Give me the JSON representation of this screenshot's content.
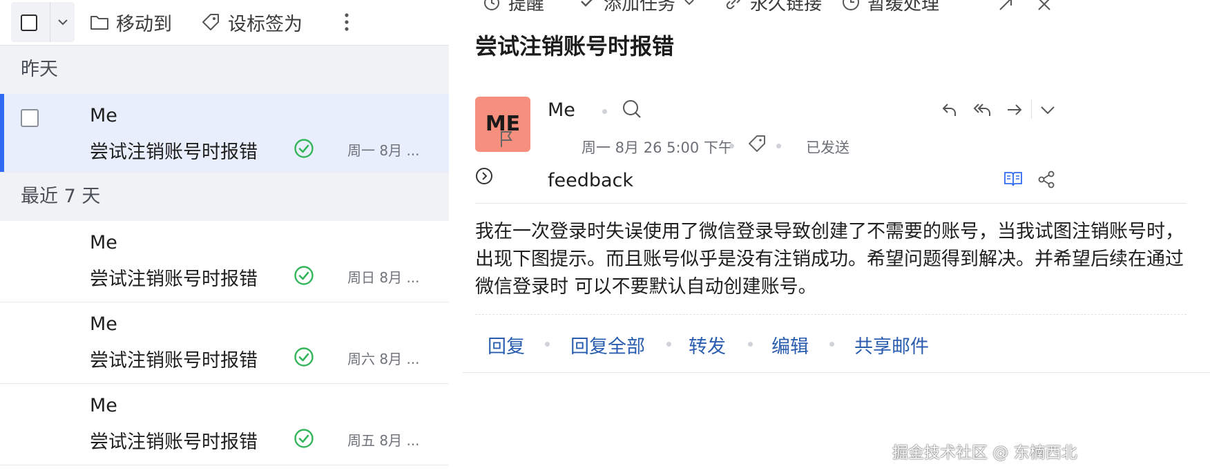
{
  "toolbar": {
    "move_to": "移动到",
    "tag_as": "设标签为"
  },
  "sections": [
    {
      "title": "昨天"
    },
    {
      "title": "最近 7 天"
    }
  ],
  "messages": [
    {
      "sender": "Me",
      "subject": "尝试注销账号时报错",
      "date": "周一 8月 ..."
    },
    {
      "sender": "Me",
      "subject": "尝试注销账号时报错",
      "date": "周日 8月 ..."
    },
    {
      "sender": "Me",
      "subject": "尝试注销账号时报错",
      "date": "周六 8月 ..."
    },
    {
      "sender": "Me",
      "subject": "尝试注销账号时报错",
      "date": "周五 8月 ..."
    }
  ],
  "reader": {
    "top_actions": {
      "reminder": "提醒",
      "add_task": "添加任务",
      "permalink": "永久链接",
      "snooze": "暂缓处理"
    },
    "subject": "尝试注销账号时报错",
    "avatar_initials": "ME",
    "avatar_color": "#f68f7d",
    "sender": "Me",
    "sent_datetime": "周一 8月 26 5:00 下午",
    "status": "已发送",
    "recipient": "feedback",
    "body": "我在一次登录时失误使用了微信登录导致创建了不需要的账号，当我试图注销账号时，出现下图提示。而且账号似乎是没有注销成功。希望问题得到解决。并希望后续在通过微信登录时 可以不要默认自动创建账号。",
    "actions": {
      "reply": "回复",
      "reply_all": "回复全部",
      "forward": "转发",
      "edit": "编辑",
      "share": "共享邮件"
    }
  },
  "colors": {
    "accent": "#2f6bf2",
    "link": "#2a5db0",
    "status_ok": "#34b55a",
    "selected_row": "#e8eefc"
  },
  "watermark": "掘金技术社区 @ 东楠西北"
}
